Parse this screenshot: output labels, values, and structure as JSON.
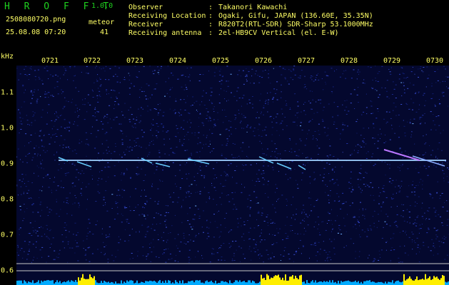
{
  "header": {
    "app_name": "H R O F F T",
    "app_version": "1.0.0",
    "filename": "2508080720.png",
    "datetime": "25.08.08 07:20",
    "meteor_label": "meteor",
    "meteor_count": "41",
    "info": [
      {
        "key": "Observer",
        "sep": ":",
        "value": "Takanori Kawachi"
      },
      {
        "key": "Receiving Location",
        "sep": ":",
        "value": "Ogaki, Gifu, JAPAN (136.60E, 35.35N)"
      },
      {
        "key": "Receiver",
        "sep": ":",
        "value": "R820T2(RTL-SDR) SDR-Sharp 53.1000MHz"
      },
      {
        "key": "Receiving antenna",
        "sep": ":",
        "value": "2el-HB9CV Vertical (el. E-W)"
      }
    ]
  },
  "axes": {
    "y_unit": "kHz",
    "x_ticks": [
      "0721",
      "0722",
      "0723",
      "0724",
      "0725",
      "0726",
      "0727",
      "0728",
      "0729",
      "0730"
    ],
    "y_ticks": [
      "1.1",
      "1.0",
      "0.9",
      "0.8",
      "0.7",
      "0.6"
    ]
  },
  "colors": {
    "background": "#000000",
    "label_yellow": "#ffff66",
    "title_green": "#1fd11f",
    "noise_base": "#04082e",
    "trace": "#9fd0ff",
    "bar_yellow": "#ffee00",
    "bar_cyan": "#00aaff"
  }
}
